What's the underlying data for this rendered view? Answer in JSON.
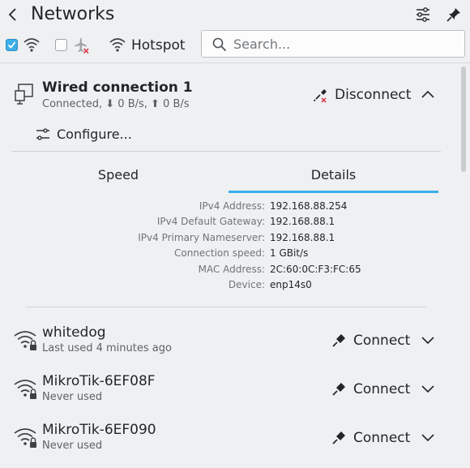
{
  "header": {
    "title": "Networks"
  },
  "toolbar": {
    "wireless_enabled": true,
    "airplane_mode": false,
    "hotspot_label": "Hotspot",
    "search_placeholder": "Search..."
  },
  "wired": {
    "name": "Wired connection 1",
    "status": "Connected, ⬇ 0 B/s, ⬆ 0 B/s",
    "action": "Disconnect",
    "configure_label": "Configure...",
    "tabs": [
      "Speed",
      "Details"
    ],
    "active_tab": "Details",
    "details": [
      {
        "key": "IPv4 Address:",
        "value": "192.168.88.254"
      },
      {
        "key": "IPv4 Default Gateway:",
        "value": "192.168.88.1"
      },
      {
        "key": "IPv4 Primary Nameserver:",
        "value": "192.168.88.1"
      },
      {
        "key": "Connection speed:",
        "value": "1 GBit/s"
      },
      {
        "key": "MAC Address:",
        "value": "2C:60:0C:F3:FC:65"
      },
      {
        "key": "Device:",
        "value": "enp14s0"
      }
    ]
  },
  "networks": [
    {
      "name": "whitedog",
      "sub": "Last used 4 minutes ago",
      "action": "Connect"
    },
    {
      "name": "MikroTik-6EF08F",
      "sub": "Never used",
      "action": "Connect"
    },
    {
      "name": "MikroTik-6EF090",
      "sub": "Never used",
      "action": "Connect"
    }
  ]
}
